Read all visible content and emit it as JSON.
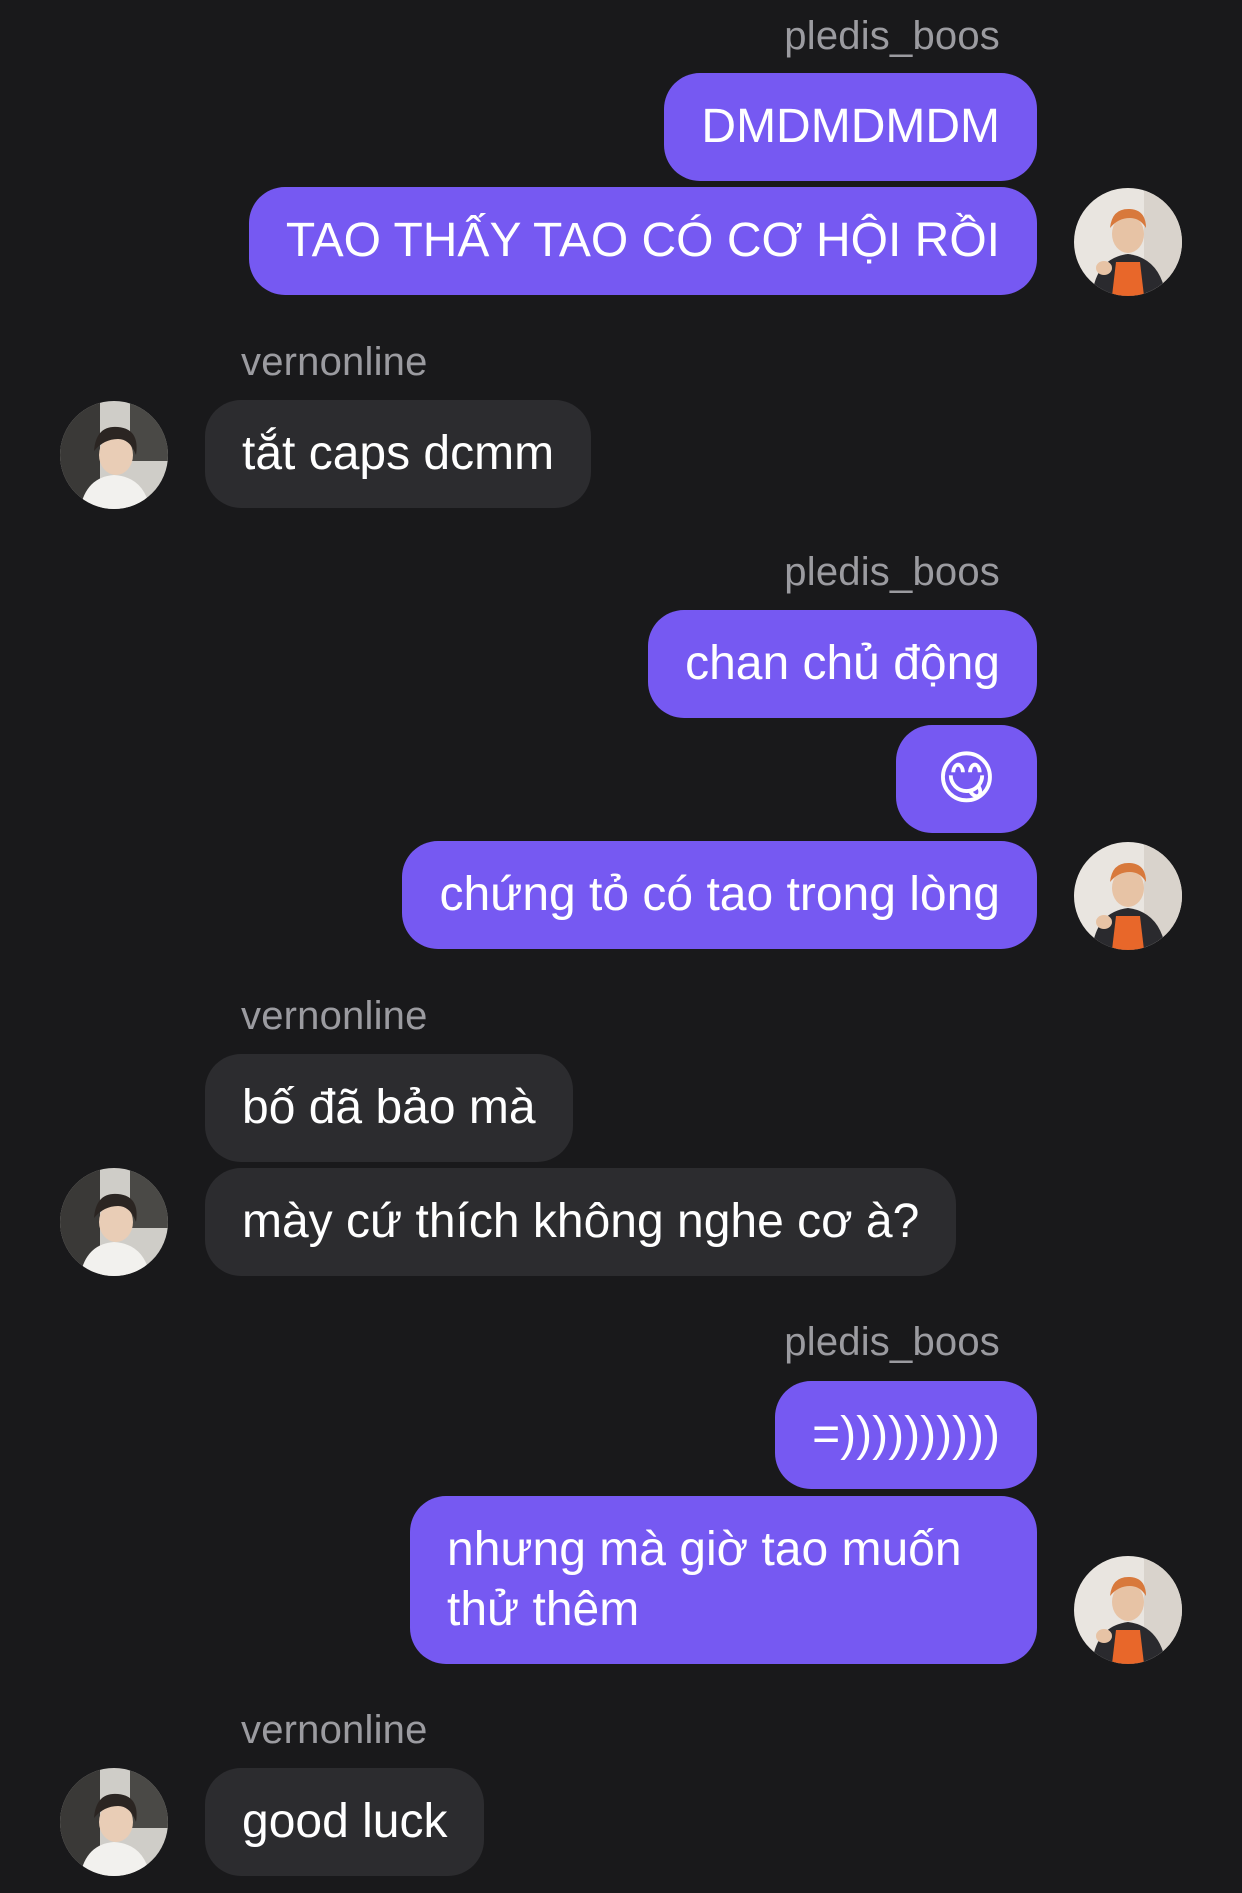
{
  "chat": {
    "groups": [
      {
        "sender": "pledis_boos",
        "messages": [
          "DMDMDMDM",
          "TAO THẤY TAO CÓ CƠ HỘI RỒI"
        ]
      },
      {
        "sender": "vernonline",
        "messages": [
          "tắt caps dcmm"
        ]
      },
      {
        "sender": "pledis_boos",
        "messages": [
          "chan chủ động",
          "😋",
          "chứng tỏ có tao trong lòng"
        ]
      },
      {
        "sender": "vernonline",
        "messages": [
          "bố đã bảo mà",
          "mày cứ thích không nghe cơ à?"
        ]
      },
      {
        "sender": "pledis_boos",
        "messages": [
          "=))))))))))",
          "nhưng mà giờ tao muốn thử thêm"
        ]
      },
      {
        "sender": "vernonline",
        "messages": [
          "good luck"
        ]
      }
    ]
  },
  "colors": {
    "background": "#19191b",
    "outgoing_bubble": "#7659f2",
    "incoming_bubble": "#2c2c2f",
    "sender_name": "#9b9ba0"
  },
  "icons": {
    "outgoing_avatar": "avatar-pledis-boos-icon",
    "incoming_avatar": "avatar-vernonline-icon"
  }
}
